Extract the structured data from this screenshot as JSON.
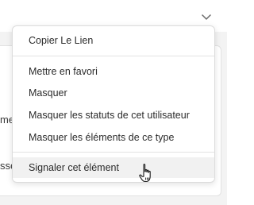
{
  "background": {
    "fragment_1": "me",
    "fragment_2": "sse"
  },
  "menu": {
    "items": [
      {
        "label": "Copier Le Lien"
      },
      {
        "label": "Mettre en favori"
      },
      {
        "label": "Masquer"
      },
      {
        "label": "Masquer les statuts de cet utilisateur"
      },
      {
        "label": "Masquer les éléments de ce type"
      },
      {
        "label": "Signaler cet élément"
      }
    ]
  },
  "icons": {
    "chevron": "chevron-down-icon",
    "cursor": "hand-pointer-cursor"
  }
}
